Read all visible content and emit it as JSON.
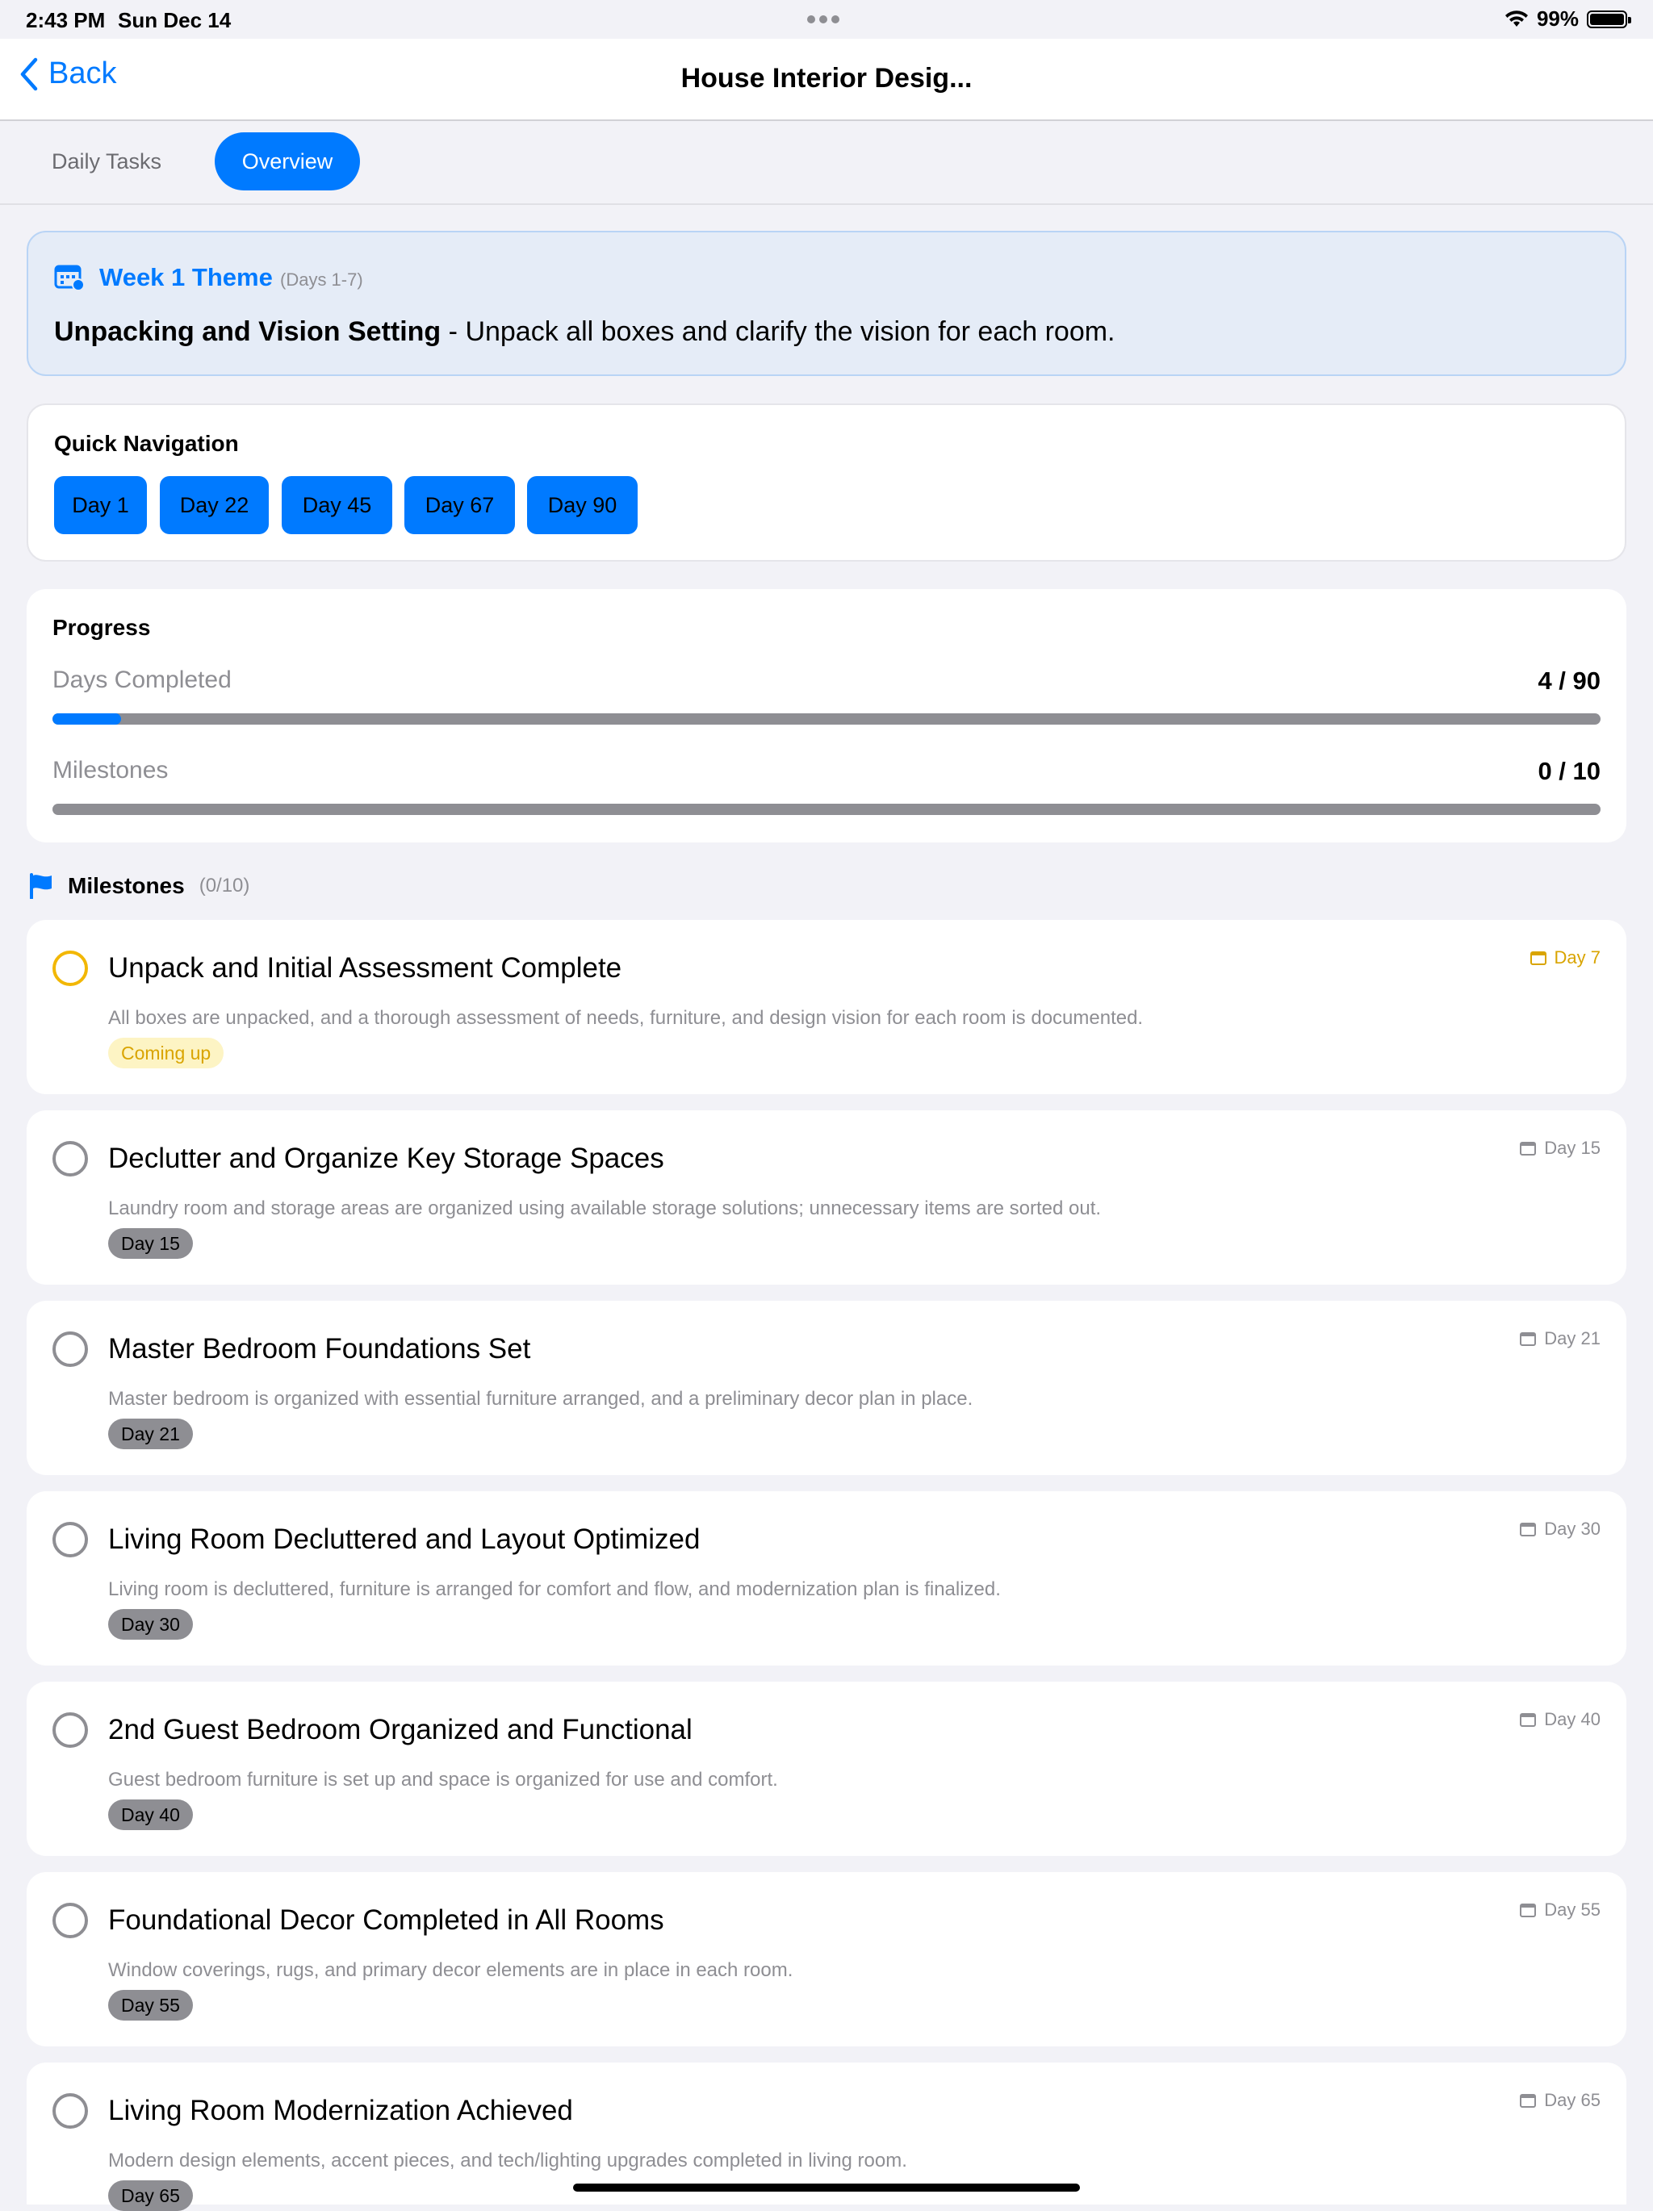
{
  "status_bar": {
    "time": "2:43 PM",
    "date": "Sun Dec 14",
    "battery": "99%"
  },
  "nav": {
    "back_label": "Back",
    "title": "House Interior Desig..."
  },
  "tabs": [
    {
      "label": "Daily Tasks",
      "selected": false
    },
    {
      "label": "Overview",
      "selected": true
    }
  ],
  "theme": {
    "title": "Week 1 Theme",
    "days": "(Days 1-7)",
    "headline": "Unpacking and Vision Setting",
    "separator": " - ",
    "description": "Unpack all boxes and clarify the vision for each room."
  },
  "quick_nav": {
    "title": "Quick Navigation",
    "buttons": [
      "Day 1",
      "Day 22",
      "Day 45",
      "Day 67",
      "Day 90"
    ]
  },
  "progress": {
    "title": "Progress",
    "days_label": "Days Completed",
    "days_value": "4 / 90",
    "days_fraction": 0.0444,
    "milestones_label": "Milestones",
    "milestones_value": "0 / 10",
    "milestones_fraction": 0
  },
  "milestones_section": {
    "title": "Milestones",
    "count": "(0/10)"
  },
  "milestones": [
    {
      "title": "Unpack and Initial Assessment Complete",
      "description": "All boxes are unpacked, and a thorough assessment of needs, furniture, and design vision for each room is documented.",
      "day": "Day 7",
      "badge": "Coming up",
      "upcoming": true
    },
    {
      "title": "Declutter and Organize Key Storage Spaces",
      "description": "Laundry room and storage areas are organized using available storage solutions; unnecessary items are sorted out.",
      "day": "Day 15",
      "badge": "Day 15",
      "upcoming": false
    },
    {
      "title": "Master Bedroom Foundations Set",
      "description": "Master bedroom is organized with essential furniture arranged, and a preliminary decor plan in place.",
      "day": "Day 21",
      "badge": "Day 21",
      "upcoming": false
    },
    {
      "title": "Living Room Decluttered and Layout Optimized",
      "description": "Living room is decluttered, furniture is arranged for comfort and flow, and modernization plan is finalized.",
      "day": "Day 30",
      "badge": "Day 30",
      "upcoming": false
    },
    {
      "title": "2nd Guest Bedroom Organized and Functional",
      "description": "Guest bedroom furniture is set up and space is organized for use and comfort.",
      "day": "Day 40",
      "badge": "Day 40",
      "upcoming": false
    },
    {
      "title": "Foundational Decor Completed in All Rooms",
      "description": "Window coverings, rugs, and primary decor elements are in place in each room.",
      "day": "Day 55",
      "badge": "Day 55",
      "upcoming": false
    },
    {
      "title": "Living Room Modernization Achieved",
      "description": "Modern design elements, accent pieces, and tech/lighting upgrades completed in living room.",
      "day": "Day 65",
      "badge": "Day 65",
      "upcoming": false
    }
  ],
  "colors": {
    "accent": "#007aff",
    "upcoming": "#d9a400",
    "muted": "#8e8e93"
  }
}
